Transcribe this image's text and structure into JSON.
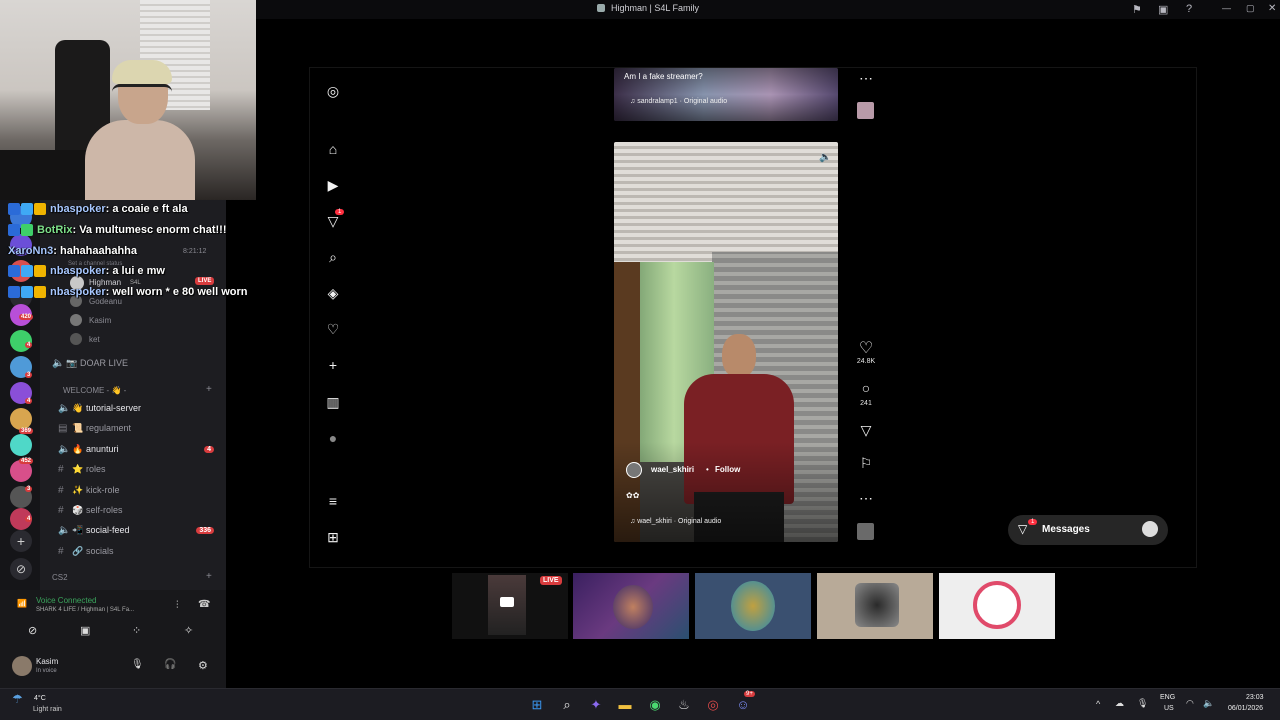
{
  "window": {
    "title": "Highman | S4L Family"
  },
  "chat": [
    {
      "user": "nbaspoker",
      "text": "a coaie e ft ala"
    },
    {
      "user": "BotRix",
      "text": "Va multumesc enorm chat!!!"
    },
    {
      "user": "XaroNn3",
      "text": "hahahaahahha"
    },
    {
      "user": "nbaspoker",
      "text": "a lui e mw"
    },
    {
      "user": "nbaspoker",
      "text": "well worn * e 80 well worn"
    }
  ],
  "discord": {
    "timestamp": "8:21:12",
    "status_hint": "Set a channel status",
    "live_user": "Highman",
    "live_badge": "LIVE",
    "live_sub": "S4L",
    "members": [
      "Godeanu",
      "Kasim",
      "ket"
    ],
    "voice_channel": "DOAR LIVE",
    "category_welcome": "WELCOME - 👋 -",
    "channels": [
      {
        "name": "tutorial-server",
        "emoji": "👋",
        "type": "voice",
        "count": ""
      },
      {
        "name": "regulament",
        "emoji": "📜",
        "type": "text",
        "count": ""
      },
      {
        "name": "anunturi",
        "emoji": "🔥",
        "type": "voice",
        "count": "4"
      },
      {
        "name": "roles",
        "emoji": "⭐",
        "type": "text",
        "count": ""
      },
      {
        "name": "kick-role",
        "emoji": "✨",
        "type": "text",
        "count": ""
      },
      {
        "name": "self-roles",
        "emoji": "🎲",
        "type": "text",
        "count": ""
      },
      {
        "name": "social-feed",
        "emoji": "📲",
        "type": "voice",
        "count": "336"
      },
      {
        "name": "socials",
        "emoji": "🔗",
        "type": "text",
        "count": ""
      }
    ],
    "category_cs2": "CS2",
    "voice_status": "Voice Connected",
    "voice_server": "SHARK 4 LIFE / Highman | S4L Fa...",
    "user_name": "Kasim",
    "user_status": "In voice",
    "guild_badges": [
      "420",
      "4",
      "3",
      "4",
      "369",
      "452",
      "3",
      "4"
    ]
  },
  "instagram": {
    "reel1_caption": "Am I a fake streamer?",
    "reel1_audio": "sandralamp1 · Original audio",
    "reel2_user": "wael_skhiri",
    "reel2_follow": "Follow",
    "reel2_audio": "wael_skhiri · Original audio",
    "likes": "24.8K",
    "comments": "241",
    "notification_count": "1",
    "messages_label": "Messages",
    "messages_count": "1"
  },
  "thumbnails": {
    "live_badge": "LIVE"
  },
  "taskbar": {
    "weather_temp": "4°C",
    "weather_desc": "Light rain",
    "lang": "ENG",
    "region": "US",
    "time": "23:03",
    "date": "06/01/2026",
    "discord_badge": "9+"
  }
}
